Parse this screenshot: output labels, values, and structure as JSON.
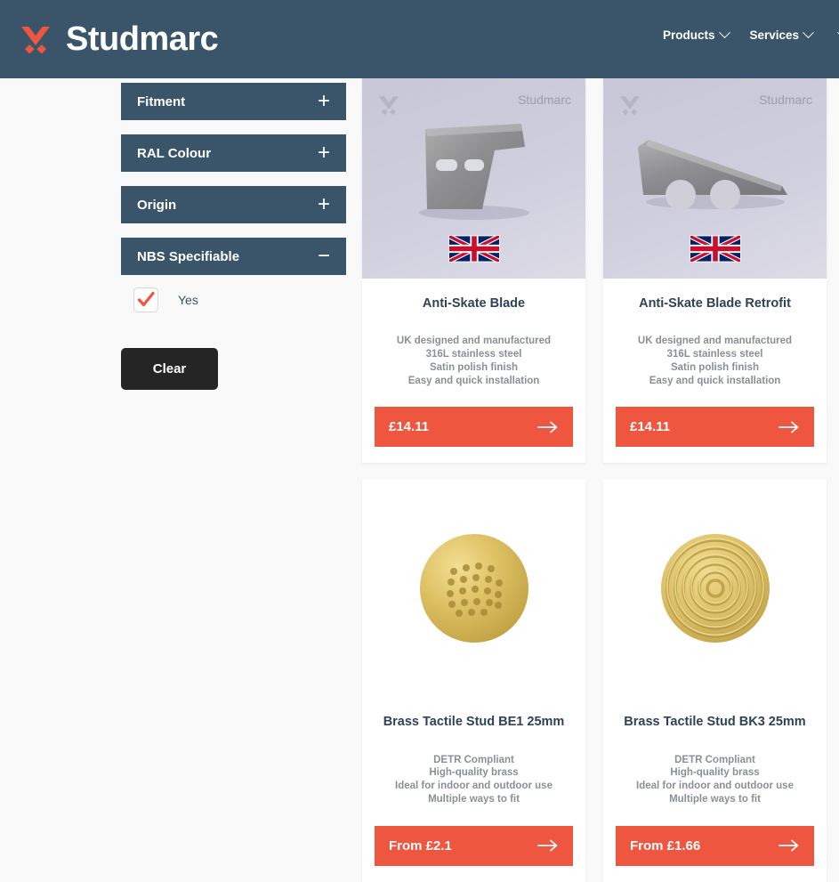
{
  "header": {
    "brand_name": "Studmarc",
    "brand_mark_icon": "studmarc-chevron-logo",
    "nav": [
      {
        "label": "Products",
        "icon": "chevron-down-icon"
      },
      {
        "label": "Services",
        "icon": "chevron-down-icon"
      },
      {
        "label": "",
        "icon": "chevron-down-icon"
      }
    ]
  },
  "colors": {
    "header_bg": "#3a5569",
    "accent": "#ef5640",
    "filter_bg": "#3a5569",
    "clear_bg": "#252525",
    "page_bg": "#f9f9f9",
    "media_bg": "#c8c7d7"
  },
  "sidebar": {
    "filters": [
      {
        "label": "Fitment",
        "sign": "+",
        "expanded": false
      },
      {
        "label": "RAL Colour",
        "sign": "+",
        "expanded": false
      },
      {
        "label": "Origin",
        "sign": "+",
        "expanded": false
      },
      {
        "label": "NBS Specifiable",
        "sign": "−",
        "expanded": true
      }
    ],
    "nbs_option": {
      "label": "Yes",
      "checked": true,
      "icon": "checkmark-icon"
    },
    "clear_label": "Clear"
  },
  "products": [
    {
      "title": "Anti-Skate Blade",
      "features": [
        "UK designed and manufactured",
        "316L stainless steel",
        "Satin polish finish",
        "Easy and quick installation"
      ],
      "price": "£14.11",
      "media": "blade-angled",
      "watermark": "Studmarc",
      "flag": "uk-flag-icon",
      "arrow": "arrow-right-icon"
    },
    {
      "title": "Anti-Skate Blade Retrofit",
      "features": [
        "UK designed and manufactured",
        "316L stainless steel",
        "Satin polish finish",
        "Easy and quick installation"
      ],
      "price": "£14.11",
      "media": "blade-wedge",
      "watermark": "Studmarc",
      "flag": "uk-flag-icon",
      "arrow": "arrow-right-icon"
    },
    {
      "title": "Brass Tactile Stud BE1 25mm",
      "features": [
        "DETR Compliant",
        "High-quality brass",
        "Ideal for indoor and outdoor use",
        "Multiple ways to fit"
      ],
      "price": "From £2.1",
      "media": "brass-stud-blister",
      "watermark": "",
      "flag": "",
      "arrow": "arrow-right-icon"
    },
    {
      "title": "Brass Tactile Stud BK3 25mm",
      "features": [
        "DETR Compliant",
        "High-quality brass",
        "Ideal for indoor and outdoor use",
        "Multiple ways to fit"
      ],
      "price": "From £1.66",
      "media": "brass-stud-concentric",
      "watermark": "",
      "flag": "",
      "arrow": "arrow-right-icon"
    }
  ]
}
